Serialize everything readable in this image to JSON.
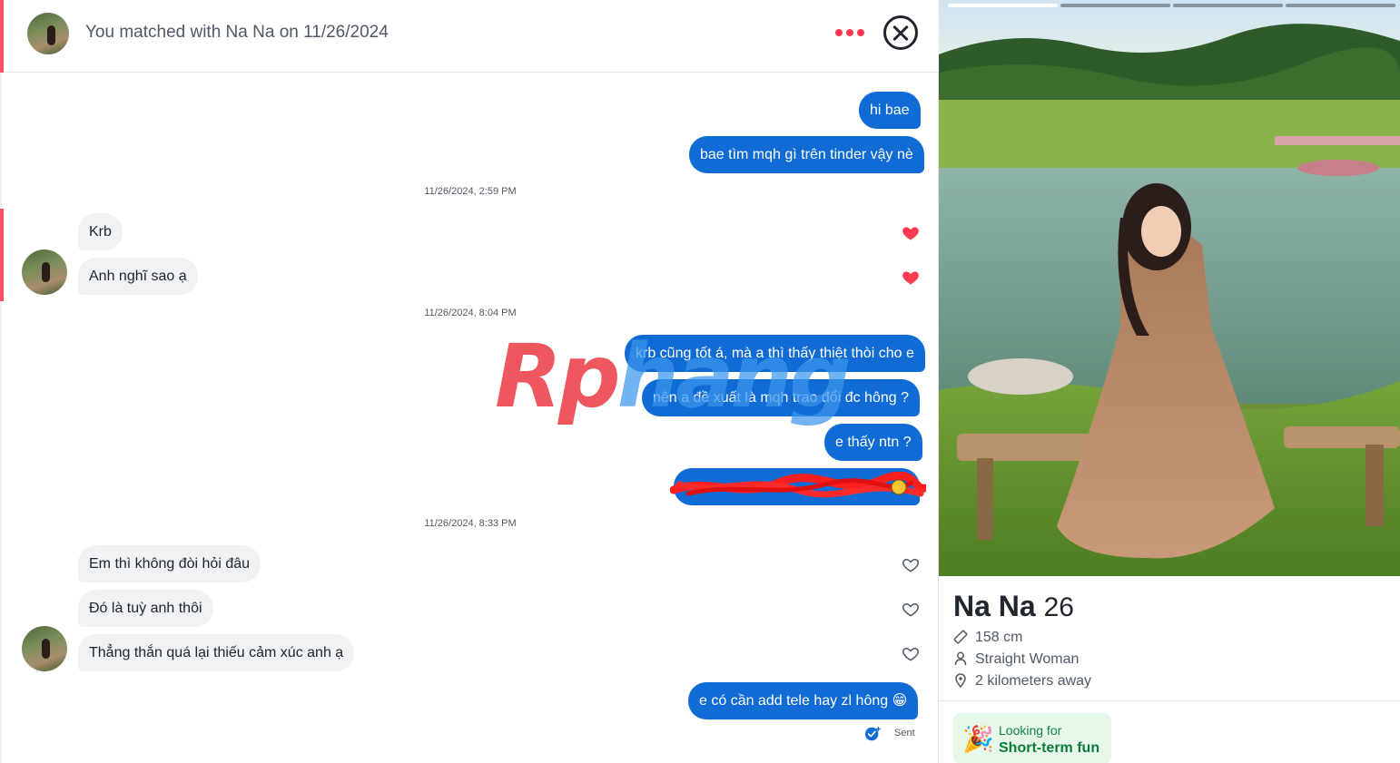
{
  "header": {
    "title": "You matched with Na Na on 11/26/2024",
    "more_icon": "more-dots-icon",
    "close_icon": "close-circle-icon"
  },
  "messages": {
    "m1": "hi bae",
    "m2": "bae tìm mqh gì trên tinder vậy nè",
    "ts1": "11/26/2024, 2:59 PM",
    "m3": "Krb",
    "m4": "Anh nghĩ sao ạ",
    "ts2": "11/26/2024, 8:04 PM",
    "m5": "krb cũng tốt á, mà a thì thấy thiệt thòi cho e",
    "m6": "nên a đề xuất là mqh trao đổi đc hông ?",
    "m7": "e thấy ntn ?",
    "ts3": "11/26/2024, 8:33 PM",
    "m9": "Em thì không đòi hỏi đâu",
    "m10": "Đó là tuỳ anh thôi",
    "m11": "Thẳng thắn quá lại thiếu cảm xúc anh ạ",
    "m12": "e có cần add tele hay zl hông 😁",
    "status": "Sent"
  },
  "watermark": {
    "part1": "Rp",
    "part2": "hang"
  },
  "profile": {
    "name": "Na Na",
    "age": "26",
    "height": "158 cm",
    "orientation": "Straight Woman",
    "distance": "2 kilometers away",
    "looking_for_label": "Looking for",
    "looking_for_value": "Short-term fun",
    "looking_for_emoji": "🎉",
    "photo_count": 4,
    "active_photo": 1
  },
  "colors": {
    "accent": "#fd5068",
    "outgoing_bubble": "#106bd5",
    "incoming_bubble": "#f0f2f4",
    "like_red": "#fd3a4f"
  }
}
